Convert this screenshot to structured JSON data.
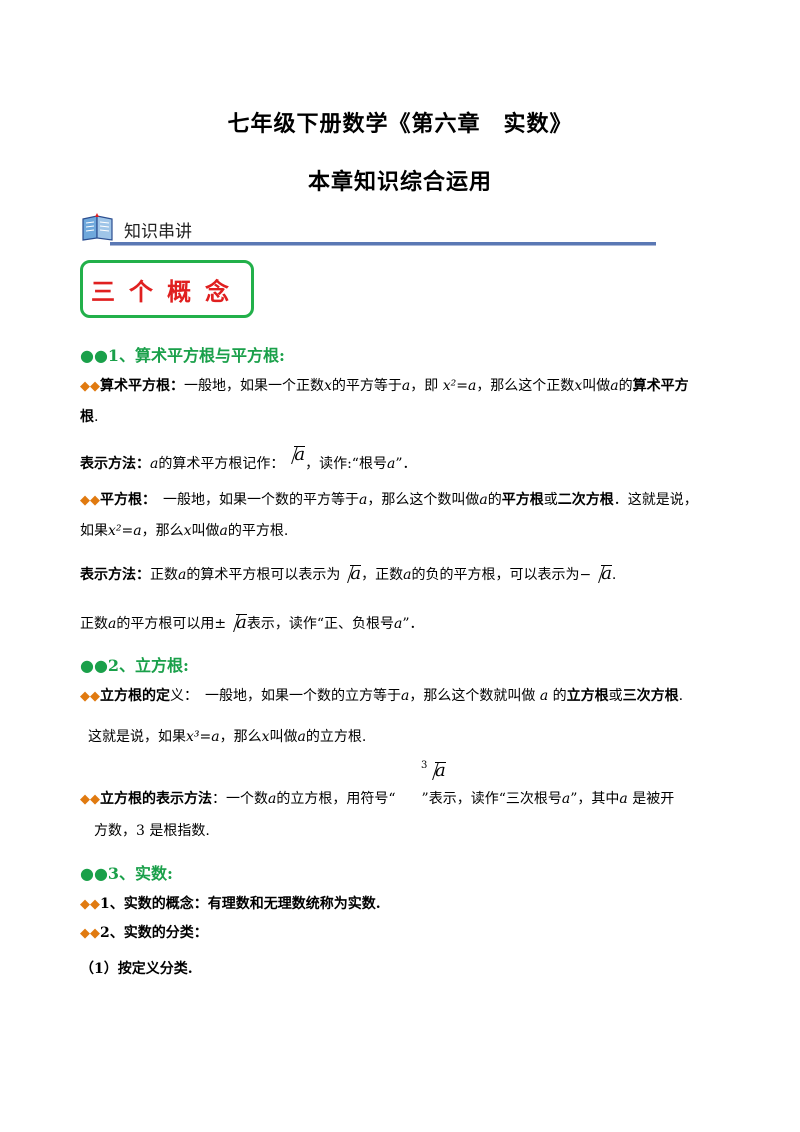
{
  "title1": "七年级下册数学《第六章　实数》",
  "title2": "本章知识综合运用",
  "banner": "知识串讲",
  "section_box": "三个概念",
  "s1": {
    "head": "●●1、算术平方根与平方根:",
    "l1_label": "算术平方根：",
    "l1_a": "一般地，如果一个正数",
    "l1_b": "的平方等于",
    "l1_c": "，即",
    "l1_eq": "x²=a",
    "l1_d": "，那么这个正数",
    "l1_e": "叫做",
    "l1_f": "的",
    "l1_bold": "算术平方",
    "l2": "根",
    "l3_label": "表示方法：",
    "l3_a": "的算术平方根记作：",
    "l3_b": "，读作:“根号",
    "l3_c": "”．",
    "l4_label": "平方根：",
    "l4_a": "一般地，如果一个数的平方等于",
    "l4_b": "，那么这个数叫做",
    "l4_c": "的",
    "l4_bold1": "平方根",
    "l4_or": "或",
    "l4_bold2": "二次方根",
    "l4_d": "．这就是说，",
    "l5_a": "如果",
    "l5_eq": "x²=a",
    "l5_b": "，那么",
    "l5_c": "叫做",
    "l5_d": "的平方根.",
    "l6_label": "表示方法：",
    "l6_a": "正数",
    "l6_b": "的算术平方根可以表示为",
    "l6_c": "，正数",
    "l6_d": "的负的平方根，可以表示为−",
    "l7_a": "正数",
    "l7_b": "的平方根可以用±",
    "l7_c": "表示，读作“正、负根号",
    "l7_d": "”．"
  },
  "s2": {
    "head": "●●2、立方根:",
    "l1_label": "立方根的定",
    "l1_label2": "义：",
    "l1_a": "一般地，如果一个数的立方等于",
    "l1_b": "，那么这个数就叫做",
    "l1_c": "的",
    "l1_bold1": "立方根",
    "l1_or": "或",
    "l1_bold2": "三次方根",
    "l2_a": "这就是说，如果",
    "l2_eq": "x³=a",
    "l2_b": "，那么",
    "l2_c": "叫做",
    "l2_d": "的立方根.",
    "l3_label": "立方根的表示方法",
    "l3_a": "：一个数",
    "l3_b": "的立方根，用符号“",
    "l3_c": "”表示，读作“三次根号",
    "l3_d": "”，其中",
    "l3_e": "是被开",
    "l4": "方数，3 是根指数."
  },
  "s3": {
    "head": "●●3、实数:",
    "l1": "1、实数的概念：有理数和无理数统称为实数.",
    "l2": "2、实数的分类：",
    "l3": "（1）按定义分类."
  },
  "var_a": "a",
  "var_x": "x",
  "colors": {
    "green": "#1aa04a",
    "orange": "#e07a10",
    "red": "#e02020",
    "blue_rule": "#5a78b4"
  }
}
